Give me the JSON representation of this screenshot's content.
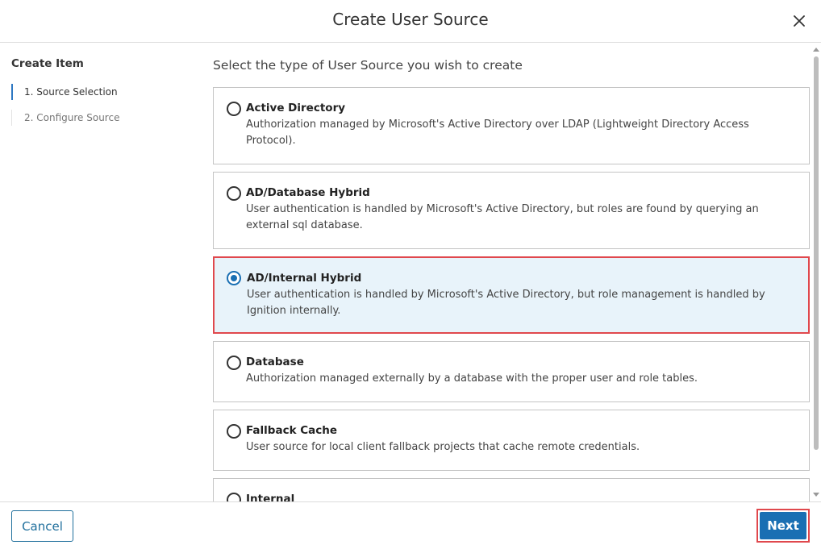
{
  "header": {
    "title": "Create User Source",
    "close_icon": "close-icon"
  },
  "sidebar": {
    "title": "Create Item",
    "steps": [
      {
        "label": "1. Source Selection",
        "active": true
      },
      {
        "label": "2. Configure Source",
        "active": false
      }
    ]
  },
  "main": {
    "heading": "Select the type of User Source you wish to create",
    "options": [
      {
        "title": "Active Directory",
        "description": "Authorization managed by Microsoft's Active Directory over LDAP (Lightweight Directory Access Protocol).",
        "selected": false
      },
      {
        "title": "AD/Database Hybrid",
        "description": "User authentication is handled by Microsoft's Active Directory, but roles are found by querying an external sql database.",
        "selected": false
      },
      {
        "title": "AD/Internal Hybrid",
        "description": "User authentication is handled by Microsoft's Active Directory, but role management is handled by Ignition internally.",
        "selected": true
      },
      {
        "title": "Database",
        "description": "Authorization managed externally by a database with the proper user and role tables.",
        "selected": false
      },
      {
        "title": "Fallback Cache",
        "description": "User source for local client fallback projects that cache remote credentials.",
        "selected": false
      },
      {
        "title": "Internal",
        "description": "",
        "selected": false
      }
    ]
  },
  "footer": {
    "cancel_label": "Cancel",
    "next_label": "Next"
  },
  "colors": {
    "accent": "#1a6fb3",
    "highlight_border": "#e0484d",
    "selected_bg": "#e8f3fa"
  }
}
